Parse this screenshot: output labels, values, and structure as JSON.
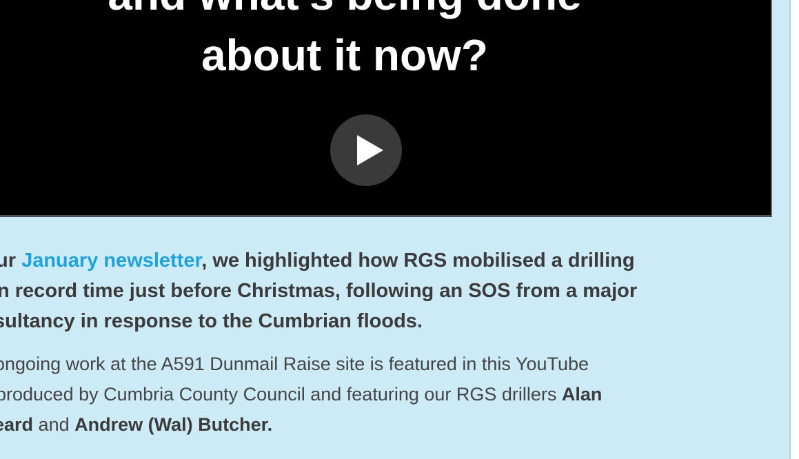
{
  "video": {
    "title_line1": "and what's being done",
    "title_line2": "about it now?"
  },
  "lead": {
    "line1_prefix": "ur ",
    "link_text": "January newsletter",
    "line1_suffix": ", we highlighted how RGS mobilised a drilling",
    "line2": "n record time just before Christmas, following an SOS from a major",
    "line3": "sultancy in response to the Cumbrian floods."
  },
  "body": {
    "line1": "ongoing work at the A591 Dunmail Raise site is featured in this YouTube",
    "line2_text": "produced by Cumbria County Council and featuring our RGS drillers ",
    "line2_bold": "Alan",
    "line3_bold1": "eard",
    "line3_mid": " and ",
    "line3_bold2": "Andrew (Wal) Butcher."
  },
  "colors": {
    "background": "#cdeaf7",
    "link": "#1fa3dc",
    "video_bg": "#000000"
  }
}
